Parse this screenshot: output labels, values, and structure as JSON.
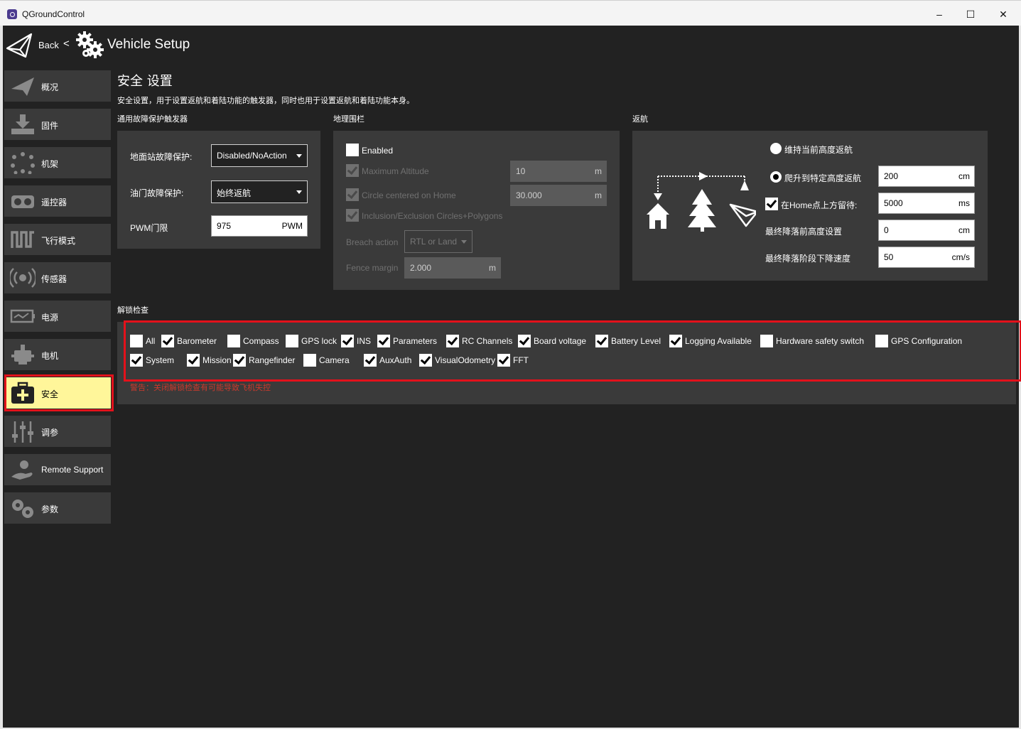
{
  "window": {
    "title": "QGroundControl",
    "controls": {
      "minimize": "–",
      "maximize": "☐",
      "close": "✕"
    }
  },
  "header": {
    "back": "Back",
    "chevron": "<",
    "title": "Vehicle Setup"
  },
  "sidebar": {
    "items": [
      {
        "label": "概况",
        "icon": "paper-plane-icon"
      },
      {
        "label": "固件",
        "icon": "download-icon"
      },
      {
        "label": "机架",
        "icon": "airframe-icon"
      },
      {
        "label": "遥控器",
        "icon": "radio-controller-icon"
      },
      {
        "label": "飞行模式",
        "icon": "flight-modes-icon"
      },
      {
        "label": "传感器",
        "icon": "sensors-icon"
      },
      {
        "label": "电源",
        "icon": "power-icon"
      },
      {
        "label": "电机",
        "icon": "motors-icon"
      },
      {
        "label": "安全",
        "icon": "safety-icon",
        "active": true
      },
      {
        "label": "调参",
        "icon": "tuning-icon"
      },
      {
        "label": "Remote Support",
        "icon": "remote-support-icon"
      },
      {
        "label": "参数",
        "icon": "parameters-icon"
      }
    ]
  },
  "page": {
    "title": "安全 设置",
    "description": "安全设置，用于设置返航和着陆功能的触发器，同时也用于设置返航和着陆功能本身。"
  },
  "failsafe": {
    "section": "通用故障保护触发器",
    "gcs_label": "地面站故障保护:",
    "gcs_value": "Disabled/NoAction",
    "throttle_label": "油门故障保护:",
    "throttle_value": "始终返航",
    "pwm_label": "PWM门限",
    "pwm_value": "975",
    "pwm_unit": "PWM"
  },
  "geofence": {
    "section": "地理围栏",
    "enabled_label": "Enabled",
    "enabled": false,
    "max_alt_label": "Maximum Altitude",
    "max_alt_value": "10",
    "max_alt_unit": "m",
    "circle_label": "Circle centered on Home",
    "circle_value": "30.000",
    "circle_unit": "m",
    "inclusion_label": "Inclusion/Exclusion Circles+Polygons",
    "breach_label": "Breach action",
    "breach_value": "RTL or Land",
    "margin_label": "Fence margin",
    "margin_value": "2.000",
    "margin_unit": "m"
  },
  "rtl": {
    "section": "返航",
    "option_current_alt": "维持当前高度返航",
    "option_climb": "爬升到特定高度返航",
    "climb_value": "200",
    "climb_unit": "cm",
    "loiter_label": "在Home点上方留待:",
    "loiter_value": "5000",
    "loiter_unit": "ms",
    "final_alt_label": "最终降落前高度设置",
    "final_alt_value": "0",
    "final_alt_unit": "cm",
    "descent_label": "最终降落阶段下降速度",
    "descent_value": "50",
    "descent_unit": "cm/s"
  },
  "arming": {
    "section": "解锁检查",
    "checks": [
      {
        "label": "All",
        "checked": false
      },
      {
        "label": "Barometer",
        "checked": true
      },
      {
        "label": "Compass",
        "checked": false
      },
      {
        "label": "GPS lock",
        "checked": false
      },
      {
        "label": "INS",
        "checked": true
      },
      {
        "label": "Parameters",
        "checked": true
      },
      {
        "label": "RC Channels",
        "checked": true
      },
      {
        "label": "Board voltage",
        "checked": true
      },
      {
        "label": "Battery Level",
        "checked": true
      },
      {
        "label": "Logging Available",
        "checked": true
      },
      {
        "label": "Hardware safety switch",
        "checked": false
      },
      {
        "label": "GPS Configuration",
        "checked": false
      },
      {
        "label": "System",
        "checked": true
      },
      {
        "label": "Mission",
        "checked": true
      },
      {
        "label": "Rangefinder",
        "checked": true
      },
      {
        "label": "Camera",
        "checked": false
      },
      {
        "label": "AuxAuth",
        "checked": true
      },
      {
        "label": "VisualOdometry",
        "checked": true
      },
      {
        "label": "FFT",
        "checked": true
      }
    ],
    "warning": "警告：关闭解锁检查有可能导致飞机失控"
  },
  "colors": {
    "background": "#222222",
    "panel": "#3a3a3a",
    "active_item": "#fff69a",
    "highlight_box": "#e3111b",
    "warning_text": "#c83a2e"
  }
}
